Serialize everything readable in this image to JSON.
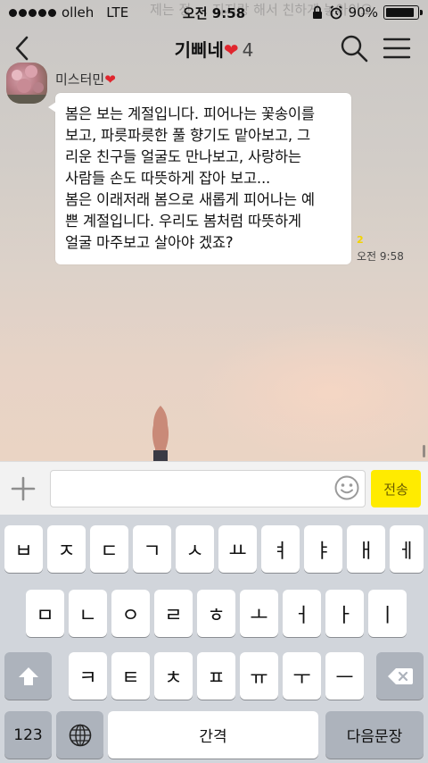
{
  "status_bar": {
    "carrier": "olleh",
    "network": "LTE",
    "time": "오전 9:58",
    "battery_percent": "90%",
    "battery_level": 0.9
  },
  "background_text": "제는 정 ... 지지랑 해서 친하게 놓아이오",
  "header": {
    "title": "기삐네",
    "title_icon": "heart-icon",
    "member_count": "4",
    "back_icon": "chevron-left-icon",
    "search_icon": "search-icon",
    "menu_icon": "hamburger-menu-icon"
  },
  "message": {
    "sender": "미스터민",
    "sender_icon": "heart-icon",
    "text": "봄은 보는 계절입니다. 피어나는 꽃송이를\n보고, 파릇파릇한 풀 향기도 맡아보고, 그\n리운 친구들 얼굴도 만나보고,  사랑하는\n사람들 손도 따뜻하게 잡아 보고...\n봄은 이래저래 봄으로 새롭게 피어나는 예\n쁜 계절입니다. 우리도 봄처럼 따뜻하게\n얼굴 마주보고 살아야 겠죠?",
    "unread_count": "2",
    "time": "오전 9:58"
  },
  "input_bar": {
    "plus_icon": "plus-icon",
    "placeholder": "",
    "emoji_icon": "emoji-icon",
    "send_label": "전송"
  },
  "keyboard": {
    "row1": [
      "ㅂ",
      "ㅈ",
      "ㄷ",
      "ㄱ",
      "ㅅ",
      "ㅛ",
      "ㅕ",
      "ㅑ",
      "ㅐ",
      "ㅔ"
    ],
    "row2": [
      "ㅁ",
      "ㄴ",
      "ㅇ",
      "ㄹ",
      "ㅎ",
      "ㅗ",
      "ㅓ",
      "ㅏ",
      "ㅣ"
    ],
    "row3": [
      "ㅋ",
      "ㅌ",
      "ㅊ",
      "ㅍ",
      "ㅠ",
      "ㅜ",
      "ㅡ"
    ],
    "numbers_label": "123",
    "space_label": "간격",
    "return_label": "다음문장",
    "shift_icon": "shift-arrow-icon",
    "backspace_icon": "backspace-icon",
    "globe_icon": "globe-icon"
  },
  "colors": {
    "send_button": "#ffeb00",
    "heart": "#e0262e",
    "unread": "#f2d300"
  }
}
